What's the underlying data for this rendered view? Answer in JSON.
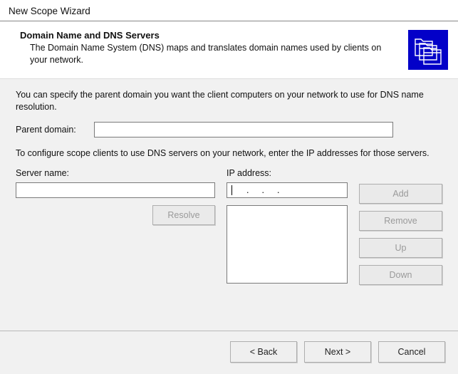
{
  "window": {
    "title": "New Scope Wizard"
  },
  "header": {
    "title": "Domain Name and DNS Servers",
    "description": "The Domain Name System (DNS) maps and translates domain names used by clients on your network.",
    "icon": "dns-folders-icon"
  },
  "content": {
    "parent_domain": {
      "instruction": "You can specify the parent domain you want the client computers on your network to use for DNS name resolution.",
      "label": "Parent domain:",
      "value": ""
    },
    "dns_servers": {
      "instruction": "To configure scope clients to use DNS servers on your network, enter the IP addresses for those servers.",
      "server_name": {
        "label": "Server name:",
        "value": ""
      },
      "ip_address": {
        "label": "IP address:",
        "value": ""
      },
      "server_list": []
    },
    "buttons": {
      "resolve": "Resolve",
      "add": "Add",
      "remove": "Remove",
      "up": "Up",
      "down": "Down"
    }
  },
  "footer": {
    "back": "< Back",
    "next": "Next >",
    "cancel": "Cancel"
  },
  "colors": {
    "content_bg": "#f1f1f1",
    "icon_bg": "#0300c8",
    "border": "#7a7a7a"
  }
}
